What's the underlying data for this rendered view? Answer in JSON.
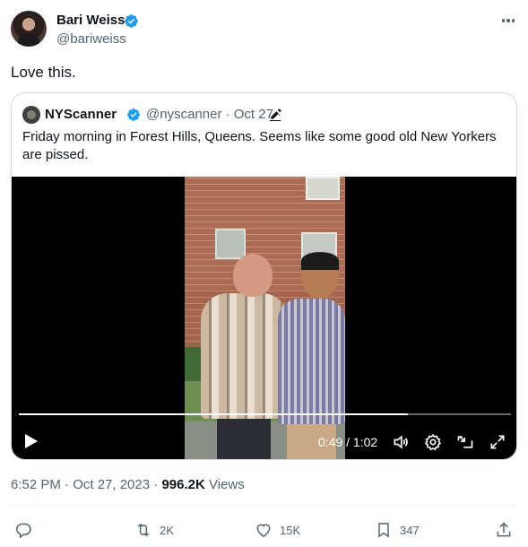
{
  "author": {
    "name": "Bari Weiss",
    "handle": "@bariweiss",
    "verified_color": "#1d9bf0"
  },
  "tweet": {
    "text": "Love this.",
    "timestamp": "6:52 PM · Oct 27, 2023",
    "separator": " · ",
    "views_count": "996.2K",
    "views_label": "Views"
  },
  "quoted": {
    "name": "NYScanner",
    "handle": "@nyscanner",
    "date": "Oct 27",
    "meta": "@nyscanner · Oct 27 ·",
    "text": "Friday morning in Forest Hills, Queens. Seems like some good old New Yorkers are pissed.",
    "video": {
      "time_display": "0:49 / 1:02",
      "progress": 0.79
    }
  },
  "actions": {
    "replies_icon": "reply-icon",
    "retweets": "2K",
    "likes": "15K",
    "bookmarks": "347",
    "share_icon": "share-icon"
  },
  "colors": {
    "text": "#0f1419",
    "muted": "#536471",
    "border": "#cfd9de",
    "accent": "#1d9bf0"
  }
}
